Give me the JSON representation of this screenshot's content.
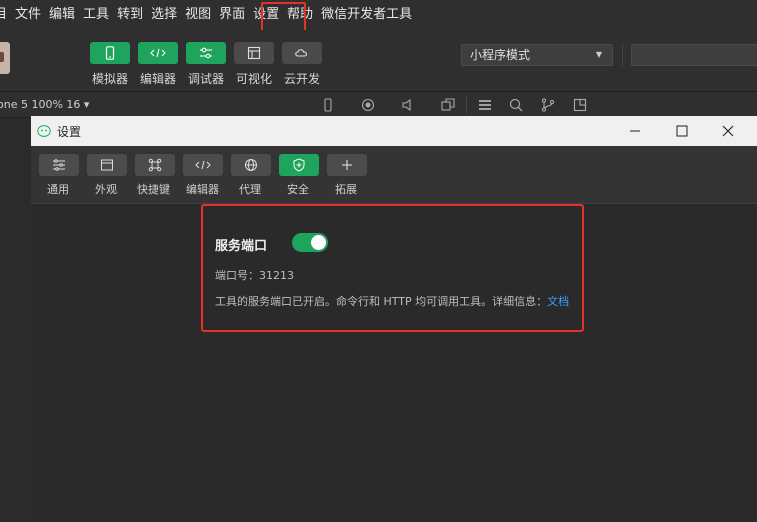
{
  "menu": [
    "目",
    "文件",
    "编辑",
    "工具",
    "转到",
    "选择",
    "视图",
    "界面",
    "设置",
    "帮助",
    "微信开发者工具"
  ],
  "toolbar": {
    "buttons": [
      {
        "label": "模拟器",
        "icon": "phone-icon"
      },
      {
        "label": "编辑器",
        "icon": "code-icon"
      },
      {
        "label": "调试器",
        "icon": "debugger-icon"
      },
      {
        "label": "可视化",
        "icon": "layout-icon"
      },
      {
        "label": "云开发",
        "icon": "cloud-icon"
      }
    ],
    "mode_select": "小程序模式"
  },
  "strip": {
    "device": "one 5 100% 16 ▾"
  },
  "dialog": {
    "title": "设置",
    "tabs": [
      {
        "label": "通用",
        "icon": "sliders-icon"
      },
      {
        "label": "外观",
        "icon": "window-icon"
      },
      {
        "label": "快捷键",
        "icon": "command-icon"
      },
      {
        "label": "编辑器",
        "icon": "code-icon"
      },
      {
        "label": "代理",
        "icon": "globe-icon"
      },
      {
        "label": "安全",
        "icon": "shield-icon"
      },
      {
        "label": "拓展",
        "icon": "plus-icon"
      }
    ],
    "service": {
      "title": "服务端口",
      "enabled": true,
      "port_label": "端口号：31213",
      "description": "工具的服务端口已开启。命令行和 HTTP 均可调用工具。详细信息：",
      "link": "文档"
    }
  },
  "colors": {
    "accent": "#1fa45d",
    "highlight": "#e53226",
    "link": "#3f9fff"
  }
}
